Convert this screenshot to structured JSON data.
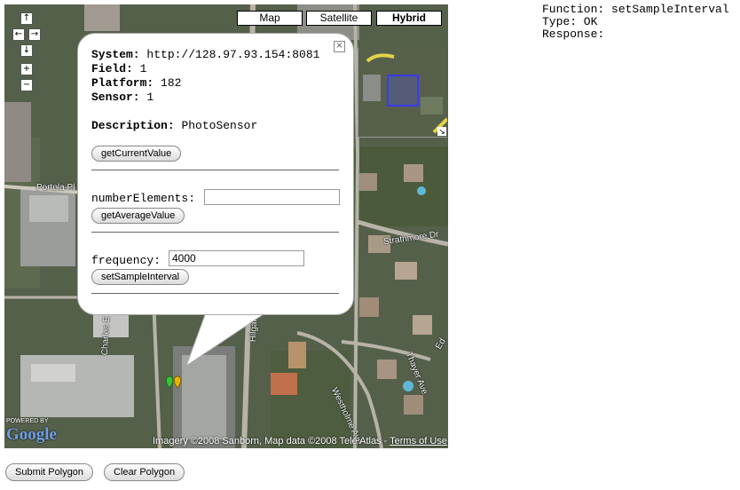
{
  "map": {
    "type_buttons": [
      "Map",
      "Satellite",
      "Hybrid"
    ],
    "active_type": "Hybrid",
    "nav": {
      "up": "↑",
      "left": "←",
      "right": "→",
      "down": "↓",
      "zoom_in": "+",
      "zoom_out": "−"
    },
    "road_labels": {
      "portola": "Portola Pl",
      "strathmore": "Strathmore Dr",
      "charles_young": "Charles E Young Dr S",
      "hilgard": "Hilgard Ave",
      "westholme": "Westholme Ave",
      "thayer": "Thayer Ave",
      "edge_label": "Ed"
    },
    "powered_by": "POWERED BY",
    "google_logo": "Google",
    "attribution": "Imagery ©2008 Sanborn, Map data ©2008 Tele Atlas - ",
    "terms_link": "Terms of Use",
    "overview_toggle": "↘",
    "marker_colors": [
      "#3cc33c",
      "#e8b400"
    ]
  },
  "popup": {
    "close_glyph": "×",
    "system_label": "System:",
    "system_value": "http://128.97.93.154:8081",
    "field_label": "Field:",
    "field_value": "1",
    "platform_label": "Platform:",
    "platform_value": "182",
    "sensor_label": "Sensor:",
    "sensor_value": "1",
    "description_label": "Description:",
    "description_value": "PhotoSensor",
    "get_current_button": "getCurrentValue",
    "number_elements_label": "numberElements:",
    "number_elements_value": "",
    "get_average_button": "getAverageValue",
    "frequency_label": "frequency:",
    "frequency_value": "4000",
    "set_sample_button": "setSampleInterval"
  },
  "status": {
    "function_line": "Function: setSampleInterval",
    "type_line": "Type: OK",
    "response_line": "Response:"
  },
  "buttons": {
    "submit_polygon": "Submit Polygon",
    "clear_polygon": "Clear Polygon"
  }
}
